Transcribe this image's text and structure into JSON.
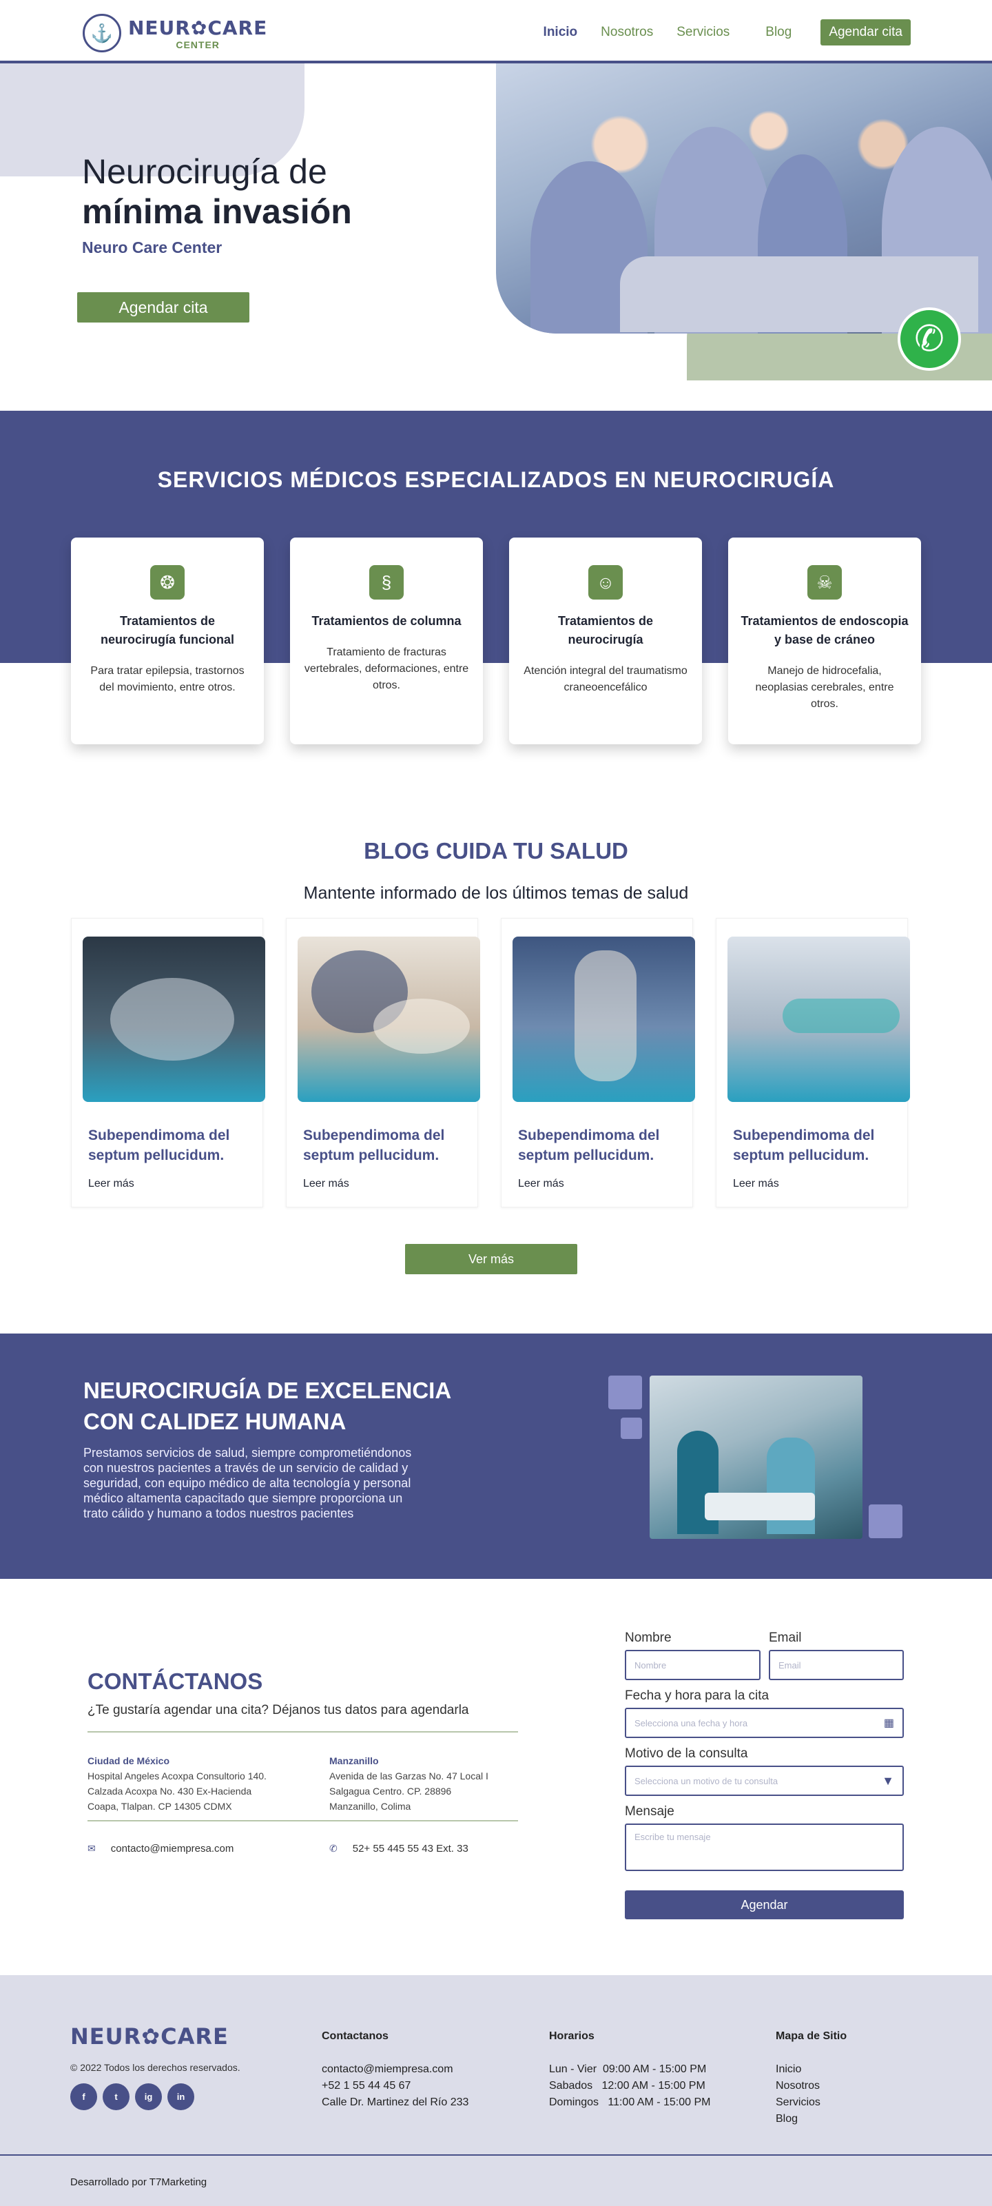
{
  "header": {
    "logo": {
      "main": "NEUR✿CARE",
      "sub": "CENTER"
    },
    "nav": [
      "Inicio",
      "Nosotros",
      "Servicios",
      "Blog"
    ],
    "nav_active": "Inicio",
    "cta": "Agendar cita"
  },
  "hero": {
    "line1": "Neurocirugía de",
    "line2": "mínima invasión",
    "line3": "Neuro Care Center",
    "cta": "Agendar cita"
  },
  "services": {
    "title": "SERVICIOS MÉDICOS ESPECIALIZADOS EN NEUROCIRUGÍA",
    "cards": [
      {
        "icon": "brain-icon",
        "title": "Tratamientos de neurocirugía funcional",
        "desc": "Para tratar epilepsia, trastornos del movimiento, entre otros."
      },
      {
        "icon": "spine-icon",
        "title": "Tratamientos de columna",
        "desc": "Tratamiento de fracturas vertebrales, deformaciones, entre otros."
      },
      {
        "icon": "head-icon",
        "title": "Tratamientos de neurocirugía",
        "desc": "Atención integral del traumatismo craneoencefálico"
      },
      {
        "icon": "skull-icon",
        "title": "Tratamientos de endoscopia y base de cráneo",
        "desc": "Manejo de hidrocefalia, neoplasias cerebrales, entre otros."
      }
    ]
  },
  "blog": {
    "title": "BLOG CUIDA TU SALUD",
    "subtitle": "Mantente informado de los últimos temas de salud",
    "posts": [
      {
        "title": "Subependimoma del septum pellucidum.",
        "more": "Leer más"
      },
      {
        "title": "Subependimoma del septum pellucidum.",
        "more": "Leer más"
      },
      {
        "title": "Subependimoma del septum pellucidum.",
        "more": "Leer más"
      },
      {
        "title": "Subependimoma del septum pellucidum.",
        "more": "Leer más"
      }
    ],
    "cta": "Ver más"
  },
  "excellence": {
    "title1": "NEUROCIRUGÍA DE EXCELENCIA",
    "title2": "CON CALIDEZ HUMANA",
    "text": "Prestamos servicios de salud, siempre comprometiéndonos con nuestros pacientes a través de un servicio de calidad y seguridad, con equipo médico de alta tecnología y personal médico altamenta capacitado que siempre proporciona un trato cálido y humano a todos nuestros pacientes"
  },
  "contact": {
    "title": "CONTÁCTANOS",
    "subtitle": "¿Te gustaría agendar una cita?  Déjanos tus datos para agendarla",
    "locations": [
      {
        "city": "Ciudad de México",
        "l1": "Hospital Angeles Acoxpa Consultorio 140.",
        "l2": "Calzada Acoxpa No. 430 Ex-Hacienda",
        "l3": "Coapa, Tlalpan. CP 14305 CDMX"
      },
      {
        "city": "Manzanillo",
        "l1": "Avenida de las Garzas No. 47 Local I",
        "l2": "Salgagua Centro. CP. 28896",
        "l3": "Manzanillo, Colima"
      }
    ],
    "email": "contacto@miempresa.com",
    "phone": "52+ 55 445 55 43 Ext. 33",
    "form": {
      "name_label": "Nombre",
      "name_ph": "Nombre",
      "email_label": "Email",
      "email_ph": "Email",
      "date_label": "Fecha y hora para la cita",
      "date_ph": "Selecciona una fecha y hora",
      "reason_label": "Motivo de la consulta",
      "reason_ph": "Selecciona un motivo de tu consulta",
      "msg_label": "Mensaje",
      "msg_ph": "Escribe tu mensaje",
      "submit": "Agendar"
    }
  },
  "footer": {
    "logo": "NEUR✿CARE",
    "copyright": "© 2022 Todos los derechos reservados.",
    "social": [
      "f",
      "t",
      "ig",
      "in"
    ],
    "contact": {
      "title": "Contactanos",
      "email": "contacto@miempresa.com",
      "phone": "+52 1 55 44 45 67",
      "address": "Calle Dr. Martinez del Río 233"
    },
    "hours": {
      "title": "Horarios",
      "rows": [
        "Lun - Vier  09:00 AM - 15:00 PM",
        "Sabados   12:00 AM - 15:00 PM",
        "Domingos   11:00 AM - 15:00 PM"
      ]
    },
    "sitemap": {
      "title": "Mapa de Sitio",
      "links": [
        "Inicio",
        "Nosotros",
        "Servicios",
        "Blog"
      ]
    },
    "developer": "Desarrollado por T7Marketing"
  },
  "colors": {
    "primary": "#485088",
    "accent": "#6a8f4f",
    "light": "#dcdde9",
    "whatsapp": "#2fb24a"
  }
}
